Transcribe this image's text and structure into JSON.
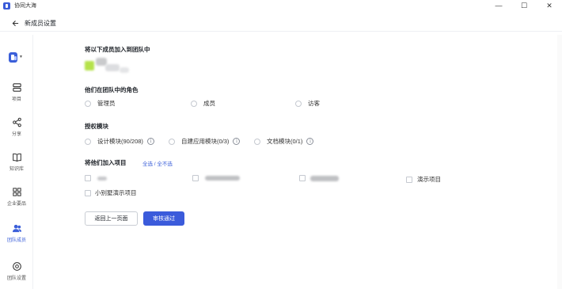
{
  "window": {
    "title": "协同大海",
    "controls": [
      "—",
      "☐",
      "✕"
    ]
  },
  "header": {
    "back_title": "新成员设置"
  },
  "sidebar": {
    "items": [
      {
        "label": "项目",
        "icon": "layers-icon"
      },
      {
        "label": "分享",
        "icon": "share-icon"
      },
      {
        "label": "知识库",
        "icon": "book-icon"
      },
      {
        "label": "企业要品",
        "icon": "grid-icon"
      },
      {
        "label": "团队成员",
        "icon": "team-icon",
        "active": true
      },
      {
        "label": "团队设置",
        "icon": "settings-icon"
      }
    ]
  },
  "main": {
    "add_members_heading": "将以下成员加入到团队中",
    "role_heading": "他们在团队中的角色",
    "roles": [
      "管理员",
      "成员",
      "访客"
    ],
    "auth_heading": "授权模块",
    "modules": [
      "设计模块(90/208)",
      "自建应用模块(0/3)",
      "文档模块(0/1)"
    ],
    "projects_heading": "将他们加入项目",
    "select_all_link": "全选 / 全不选",
    "projects": [
      "演示项目",
      "小别墅演示项目"
    ],
    "back_button": "返回上一页面",
    "approve_button": "审核通过"
  },
  "colors": {
    "accent": "#3b5bdb",
    "avatar": "#b5e24a"
  }
}
